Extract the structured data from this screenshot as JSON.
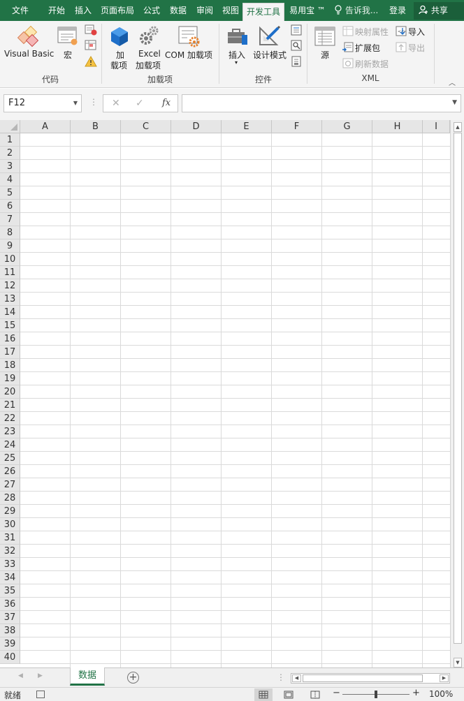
{
  "tabs": [
    {
      "label": "文件",
      "active": false
    },
    {
      "label": "开始",
      "active": false
    },
    {
      "label": "插入",
      "active": false
    },
    {
      "label": "页面布局",
      "active": false
    },
    {
      "label": "公式",
      "active": false
    },
    {
      "label": "数据",
      "active": false
    },
    {
      "label": "审阅",
      "active": false
    },
    {
      "label": "视图",
      "active": false
    },
    {
      "label": "开发工具",
      "active": true
    },
    {
      "label": "易用宝 ™",
      "active": false
    }
  ],
  "tell_me": "告诉我...",
  "login": "登录",
  "share": "共享",
  "ribbon": {
    "groups": {
      "code": "代码",
      "addins": "加载项",
      "controls": "控件",
      "xml": "XML"
    },
    "visual_basic": "Visual Basic",
    "macros": "宏",
    "addins_line1": "加",
    "addins_line2": "载项",
    "excel_addins_line1": "Excel",
    "excel_addins_line2": "加载项",
    "com_addins": "COM 加载项",
    "insert": "插入",
    "design_mode": "设计模式",
    "source": "源",
    "map_properties": "映射属性",
    "expansion_packs": "扩展包",
    "refresh_data": "刷新数据",
    "import": "导入",
    "export": "导出"
  },
  "formula_bar": {
    "name_box": "F12",
    "formula": ""
  },
  "columns": [
    "A",
    "B",
    "C",
    "D",
    "E",
    "F",
    "G",
    "H",
    "I"
  ],
  "rows": [
    "1",
    "2",
    "3",
    "4",
    "5",
    "6",
    "7",
    "8",
    "9",
    "10",
    "11",
    "12",
    "13",
    "14",
    "15",
    "16",
    "17",
    "18",
    "19",
    "20",
    "21",
    "22",
    "23",
    "24",
    "25",
    "26",
    "27",
    "28",
    "29",
    "30",
    "31",
    "32",
    "33",
    "34",
    "35",
    "36",
    "37",
    "38",
    "39",
    "40"
  ],
  "sheet_tabs": [
    "数据"
  ],
  "status": {
    "ready": "就绪",
    "zoom": "100%",
    "zoom_fraction": 0.5
  },
  "colors": {
    "accent": "#217346",
    "accent_dark": "#1b5f3a",
    "ribbon_bg": "#f4f4f4",
    "header_bg": "#e6e6e6"
  }
}
